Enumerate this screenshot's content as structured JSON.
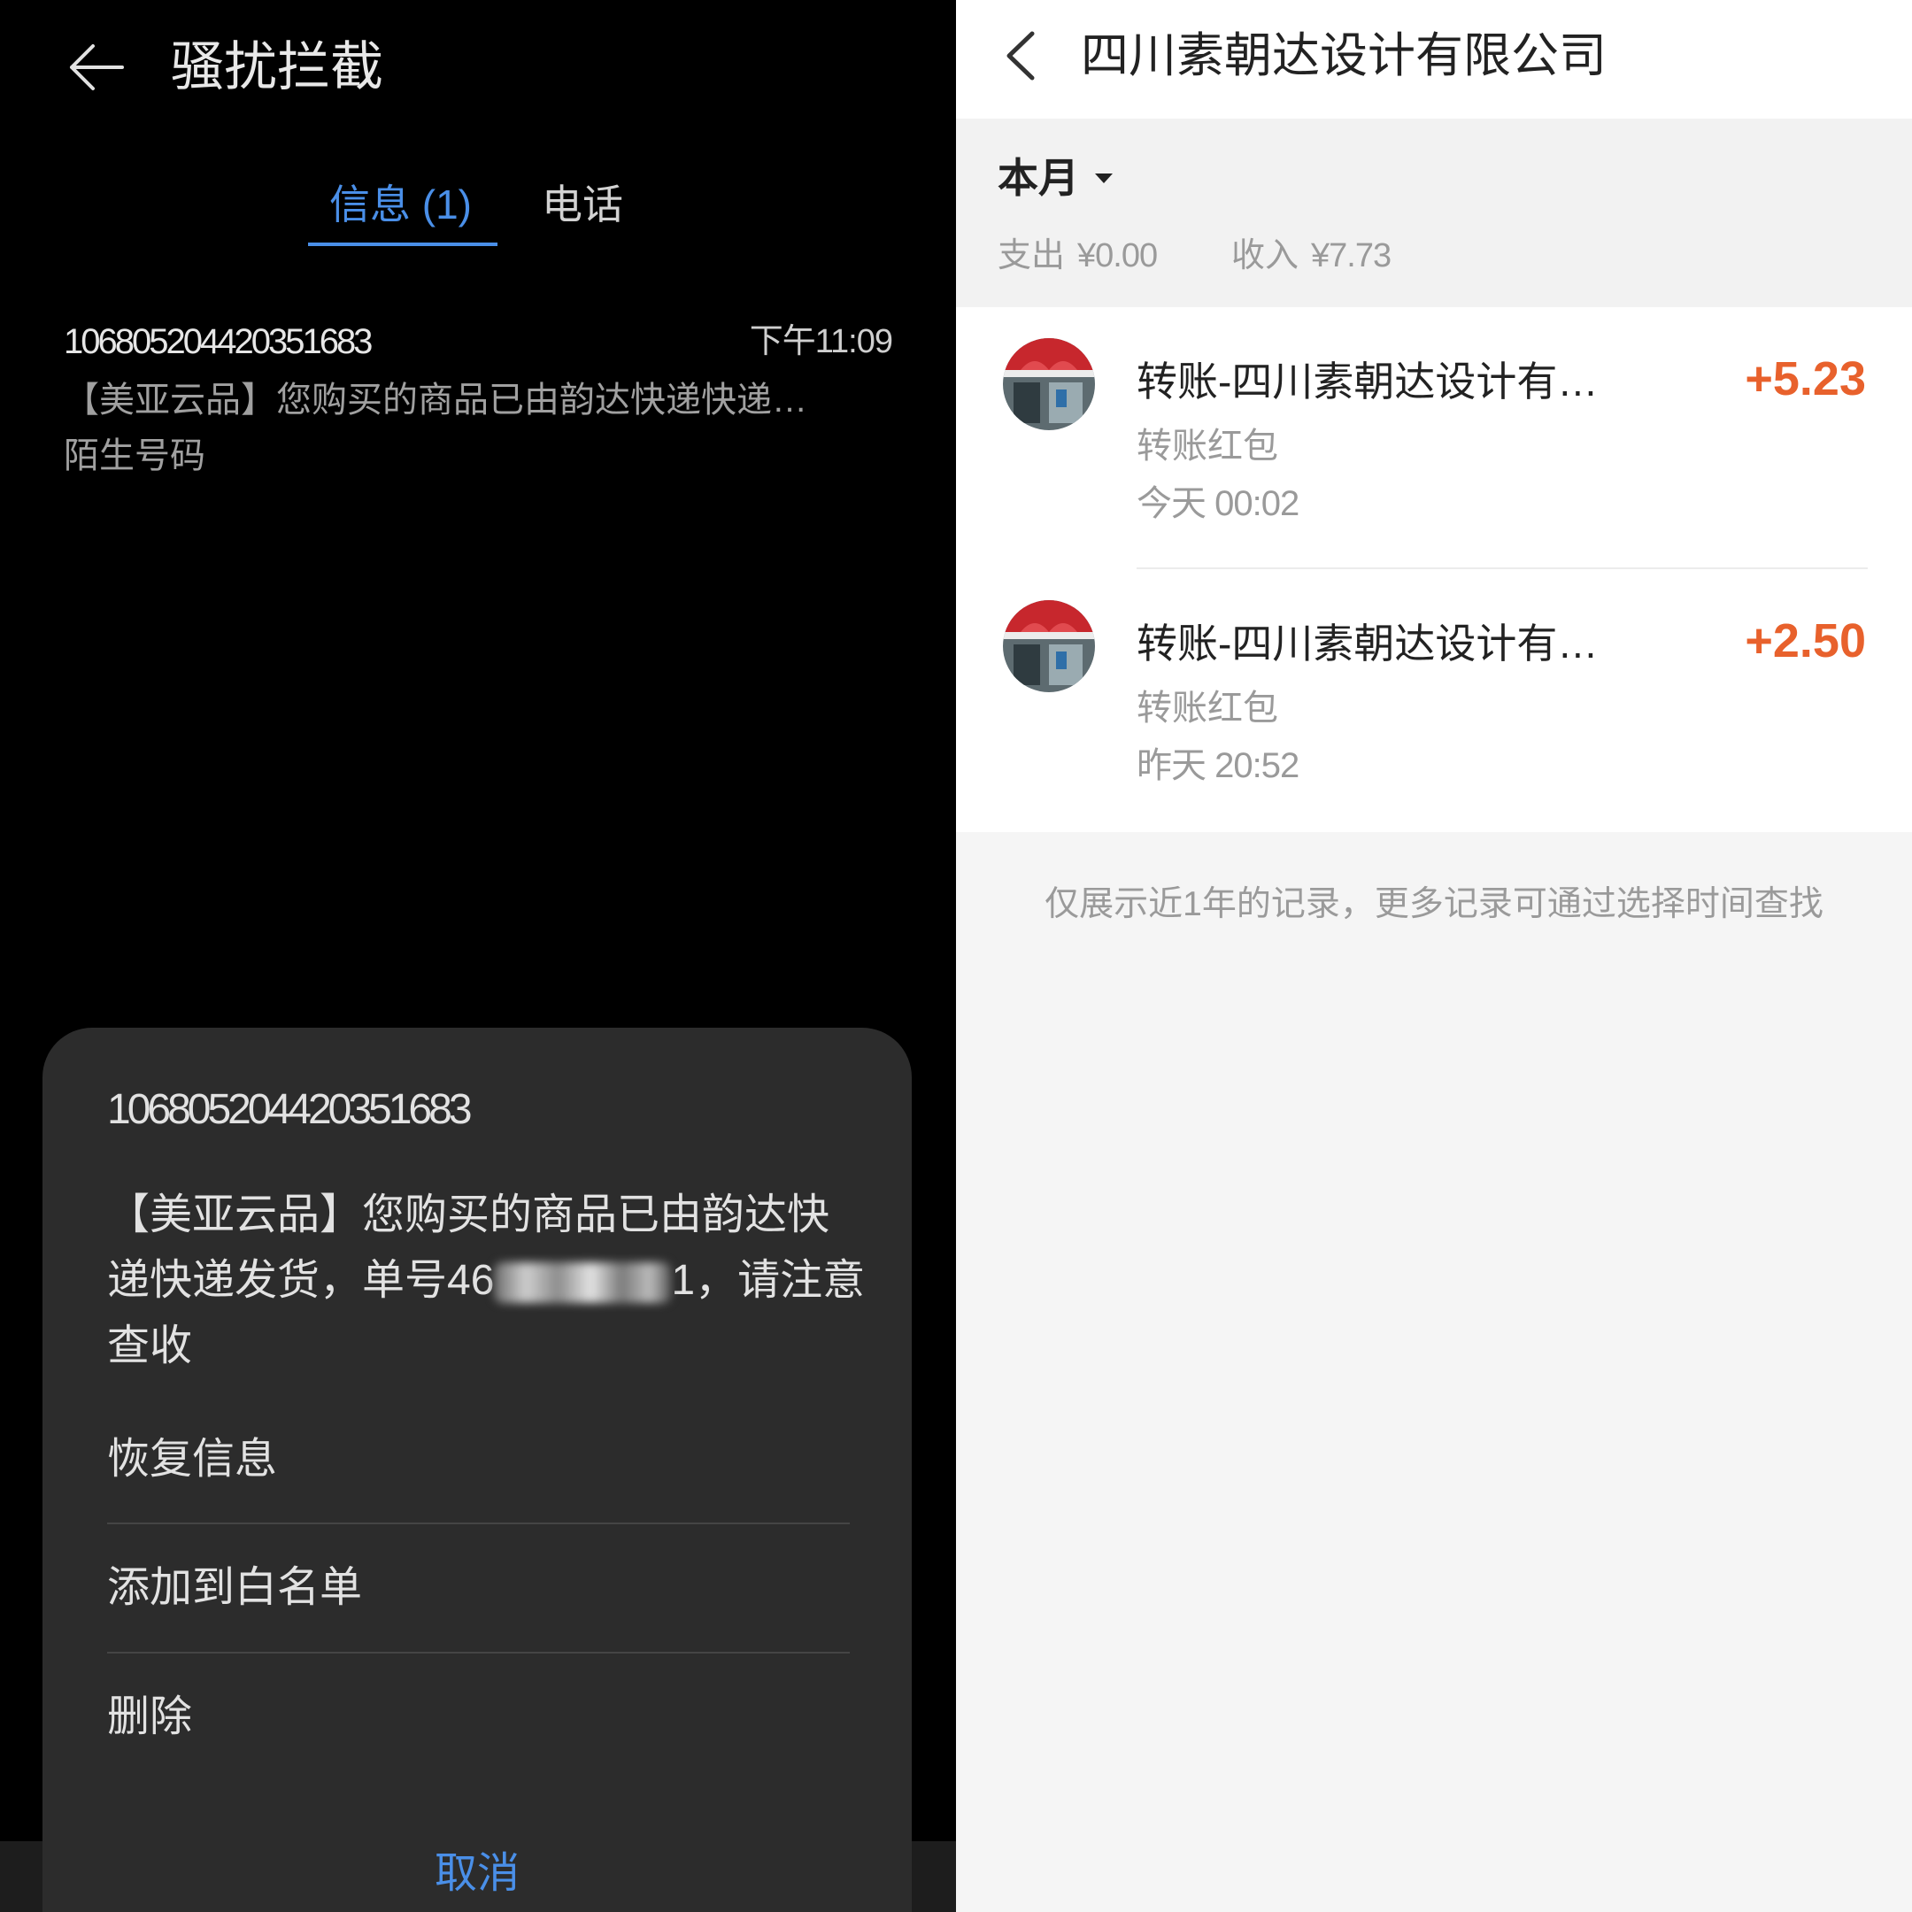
{
  "theme": {
    "accent": "#4a8fe8",
    "amount_color": "#e8612c",
    "left_background": "#000000",
    "sheet_background": "#2c2c2c",
    "right_background": "#f5f5f5"
  },
  "icons": {
    "left_back": "back-arrow-icon",
    "right_back": "back-chevron-icon",
    "month_caret": "caret-down-icon"
  },
  "left": {
    "header": {
      "title": "骚扰拦截"
    },
    "tabs": [
      {
        "label": "信息 (1)",
        "active": true
      },
      {
        "label": "电话",
        "active": false
      }
    ],
    "message": {
      "sender": "106805204420351683",
      "time": "下午11:09",
      "preview": "【美亚云品】您购买的商品已由韵达快递快递…",
      "tag": "陌生号码"
    },
    "sheet": {
      "sender": "106805204420351683",
      "body": {
        "line1": "【美亚云品】您购买的商品已由韵达快",
        "line2_before": "递快递发货，单号46",
        "line2_after": "1，请注意",
        "line3": "查收"
      },
      "actions": [
        "恢复信息",
        "添加到白名单",
        "删除"
      ],
      "cancel": "取消"
    }
  },
  "right": {
    "header": {
      "title": "四川素朝达设计有限公司"
    },
    "filter": {
      "month": "本月",
      "expense_label": "支出",
      "expense_value": "¥0.00",
      "income_label": "收入",
      "income_value": "¥7.73"
    },
    "transactions": [
      {
        "title": "转账-四川素朝达设计有…",
        "amount": "+5.23",
        "type": "转账红包",
        "date": "今天 00:02"
      },
      {
        "title": "转账-四川素朝达设计有…",
        "amount": "+2.50",
        "type": "转账红包",
        "date": "昨天 20:52"
      }
    ],
    "note": "仅展示近1年的记录，更多记录可通过选择时间查找"
  }
}
